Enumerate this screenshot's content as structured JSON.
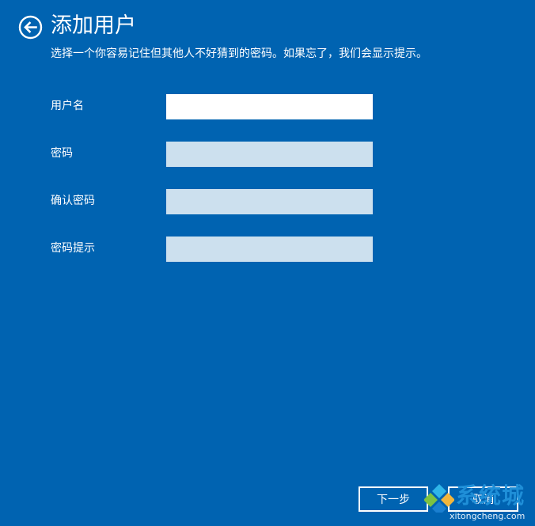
{
  "header": {
    "title": "添加用户",
    "subtitle": "选择一个你容易记住但其他人不好猜到的密码。如果忘了，我们会显示提示。",
    "back_icon": "back-arrow-circle-icon"
  },
  "form": {
    "fields": [
      {
        "label": "用户名",
        "value": ""
      },
      {
        "label": "密码",
        "value": ""
      },
      {
        "label": "确认密码",
        "value": ""
      },
      {
        "label": "密码提示",
        "value": ""
      }
    ]
  },
  "buttons": {
    "next_label": "下一步",
    "cancel_label": "取消"
  },
  "watermark": {
    "brand_cn": "系统城",
    "brand_url": "xitongcheng.com"
  },
  "colors": {
    "background": "#0063b1",
    "text": "#ffffff",
    "active_input": "#ffffff",
    "inactive_input": "#cce0ee"
  }
}
